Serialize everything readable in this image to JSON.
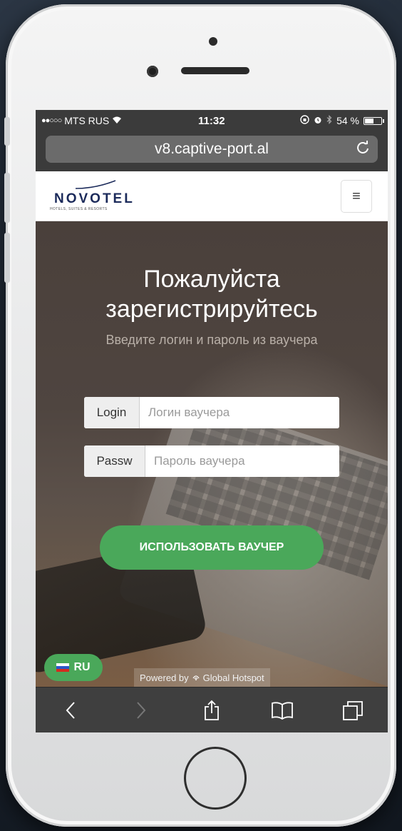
{
  "status_bar": {
    "carrier": "MTS RUS",
    "time": "11:32",
    "battery": "54 %",
    "battery_level": 0.54
  },
  "browser": {
    "url": "v8.captive-port.al"
  },
  "header": {
    "brand": "NOVOTEL",
    "tagline": "HOTELS, SUITES & RESORTS",
    "menu_label": "≡"
  },
  "hero": {
    "title_line1": "Пожалуйста",
    "title_line2": "зарегистрируйтесь",
    "subtitle": "Введите логин и пароль из ваучера"
  },
  "form": {
    "login_label": "Login",
    "login_placeholder": "Логин ваучера",
    "password_label": "Passw",
    "password_placeholder": "Пароль ваучера",
    "submit_label": "ИСПОЛЬЗОВАТЬ ВАУЧЕР"
  },
  "footer": {
    "language": "RU",
    "powered_prefix": "Powered by",
    "powered_brand": "Global Hotspot"
  },
  "colors": {
    "accent_green": "#4aa85a",
    "brand_navy": "#1b2a5a"
  }
}
